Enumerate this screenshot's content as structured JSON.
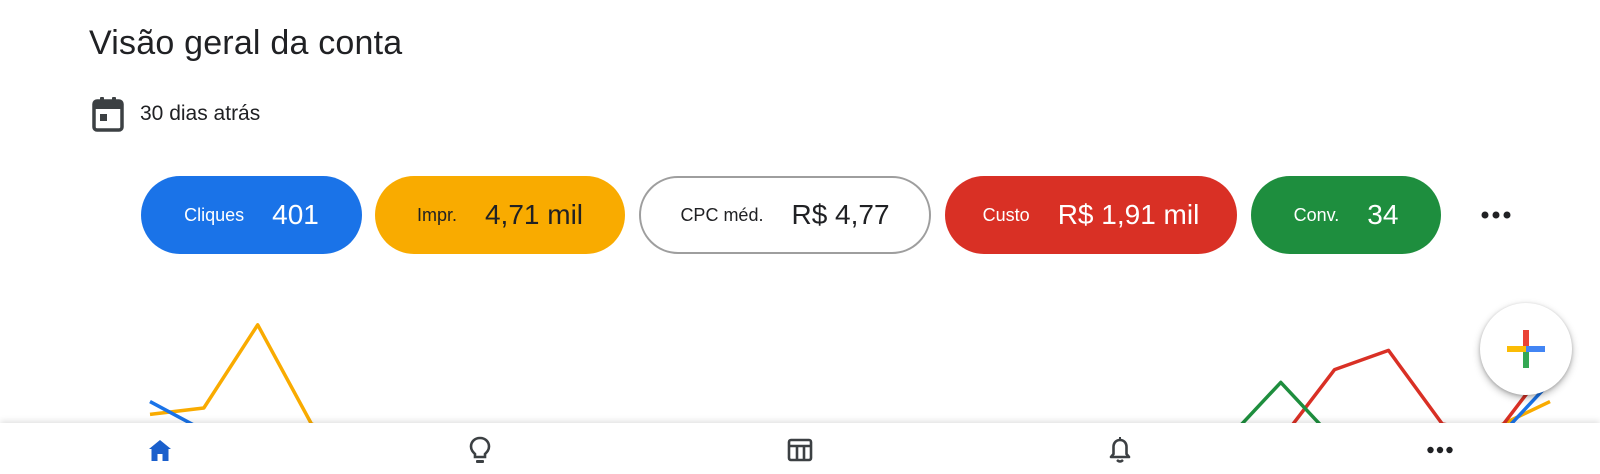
{
  "header": {
    "title": "Visão geral da conta"
  },
  "date_range": {
    "label": "30 dias atrás",
    "icon": "calendar-icon"
  },
  "metrics": [
    {
      "id": "clicks",
      "label": "Cliques",
      "value": "401",
      "color": "#1a73e8",
      "selected": true
    },
    {
      "id": "impressions",
      "label": "Impr.",
      "value": "4,71 mil",
      "color": "#f9ab00",
      "selected": true
    },
    {
      "id": "cpc",
      "label": "CPC méd.",
      "value": "R$ 4,77",
      "color": "#ffffff",
      "selected": false
    },
    {
      "id": "cost",
      "label": "Custo",
      "value": "R$ 1,91 mil",
      "color": "#d93025",
      "selected": true
    },
    {
      "id": "conversions",
      "label": "Conv.",
      "value": "34",
      "color": "#1e8e3e",
      "selected": true
    }
  ],
  "more_metrics_icon": "more-horizontal-icon",
  "fab": {
    "icon": "google-plus-icon",
    "colors": [
      "#4285f4",
      "#ea4335",
      "#fbbc05",
      "#34a853"
    ]
  },
  "bottom_nav": [
    {
      "id": "home",
      "icon": "home-icon",
      "active": true
    },
    {
      "id": "recommendations",
      "icon": "lightbulb-icon",
      "active": false
    },
    {
      "id": "campaigns",
      "icon": "table-icon",
      "active": false
    },
    {
      "id": "notifications",
      "icon": "bell-icon",
      "active": false
    },
    {
      "id": "more",
      "icon": "more-horizontal-icon",
      "active": false
    }
  ],
  "chart_data": {
    "type": "line",
    "title": "",
    "series": [
      {
        "color": "#f9ab00",
        "values": [
          8,
          10,
          36,
          5,
          0,
          0,
          0,
          0,
          0,
          0,
          0,
          0,
          0,
          0,
          0,
          0,
          0,
          0,
          0,
          0,
          0,
          0,
          0,
          0,
          2,
          4,
          12
        ]
      },
      {
        "color": "#1a73e8",
        "values": [
          12,
          3,
          3,
          0,
          0,
          0,
          0,
          0,
          0,
          0,
          0,
          0,
          0,
          0,
          0,
          0,
          0,
          0,
          0,
          0,
          0,
          0,
          0,
          0,
          0,
          0,
          18
        ]
      },
      {
        "color": "#d93025",
        "values": [
          0,
          0,
          0,
          0,
          0,
          0,
          0,
          0,
          0,
          0,
          0,
          0,
          0,
          0,
          0,
          0,
          0,
          0,
          0,
          0,
          0,
          0,
          22,
          28,
          5,
          2,
          24
        ]
      },
      {
        "color": "#1e8e3e",
        "values": [
          0,
          0,
          0,
          0,
          0,
          0,
          0,
          0,
          0,
          0,
          0,
          0,
          0,
          0,
          0,
          0,
          0,
          0,
          0,
          0,
          0,
          18,
          0,
          0,
          0,
          0,
          0
        ]
      }
    ]
  }
}
